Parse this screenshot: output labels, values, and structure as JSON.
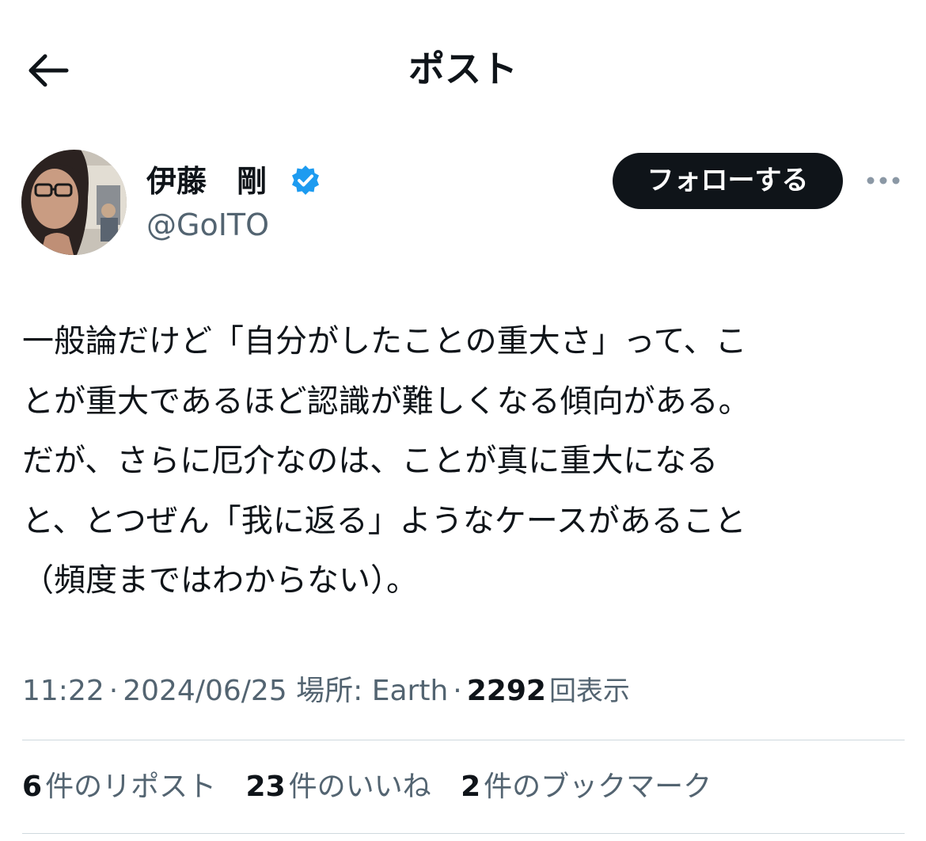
{
  "header": {
    "title": "ポスト",
    "back_icon": "back-arrow-icon"
  },
  "author": {
    "display_name": "伊藤　剛",
    "handle": "@GoITO",
    "verified_icon": "verified-badge-icon",
    "verified_color": "#1d9bf0"
  },
  "follow_button": {
    "label": "フォローする"
  },
  "more_icon": "more-options-icon",
  "post": {
    "lines": [
      "一般論だけど「自分がしたことの重大さ」って、こ",
      "とが重大であるほど認識が難しくなる傾向がある。",
      "だが、さらに厄介なのは、ことが真に重大になる",
      "と、とつぜん「我に返る」ようなケースがあること",
      "（頻度まではわからない）。"
    ]
  },
  "meta": {
    "time": "11:22",
    "date": "2024/06/25",
    "location": "場所: Earth",
    "views_count": "2292",
    "views_label": "回表示"
  },
  "stats": {
    "reposts": {
      "count": "6",
      "label": "件のリポスト"
    },
    "likes": {
      "count": "23",
      "label": "件のいいね"
    },
    "bookmarks": {
      "count": "2",
      "label": "件のブックマーク"
    }
  },
  "colors": {
    "text_primary": "#0f1419",
    "text_secondary": "#536471",
    "divider": "#cfd9de",
    "button_bg": "#0f1419",
    "button_text": "#ffffff"
  }
}
